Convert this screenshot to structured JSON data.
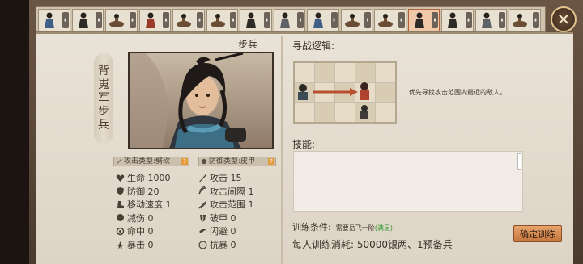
{
  "roster": [
    {
      "id": "unit-1",
      "icon": "figure-blue"
    },
    {
      "id": "unit-2",
      "icon": "figure-dark"
    },
    {
      "id": "unit-3",
      "icon": "figure-horse"
    },
    {
      "id": "unit-4",
      "icon": "figure-red"
    },
    {
      "id": "unit-5",
      "icon": "figure-horse"
    },
    {
      "id": "unit-6",
      "icon": "figure-horse"
    },
    {
      "id": "unit-7",
      "icon": "figure-dark"
    },
    {
      "id": "unit-8",
      "icon": "figure-grey"
    },
    {
      "id": "unit-9",
      "icon": "figure-blue"
    },
    {
      "id": "unit-10",
      "icon": "figure-horse"
    },
    {
      "id": "unit-11",
      "icon": "figure-horse"
    },
    {
      "id": "unit-12",
      "icon": "figure-dark",
      "active": true
    },
    {
      "id": "unit-13",
      "icon": "figure-dark"
    },
    {
      "id": "unit-14",
      "icon": "figure-grey"
    },
    {
      "id": "unit-15",
      "icon": "figure-horse"
    }
  ],
  "unit": {
    "type": "步兵",
    "name_chars": [
      "背",
      "嵬",
      "军",
      "步",
      "兵"
    ]
  },
  "types": {
    "attack": "攻击类型:劈砍",
    "defense": "防御类型:皮甲",
    "help_symbol": "?"
  },
  "stats_left": [
    {
      "icon": "heart-icon",
      "text": "生命 1000"
    },
    {
      "icon": "shield-icon",
      "text": "防御 20"
    },
    {
      "icon": "boot-icon",
      "text": "移动速度 1"
    },
    {
      "icon": "reduce-damage-icon",
      "text": "减伤 0"
    },
    {
      "icon": "accuracy-icon",
      "text": "命中 0"
    },
    {
      "icon": "critical-icon",
      "text": "暴击 0"
    }
  ],
  "stats_right": [
    {
      "icon": "sword-icon",
      "text": "攻击 15"
    },
    {
      "icon": "attack-interval-icon",
      "text": "攻击间隔 1"
    },
    {
      "icon": "attack-range-icon",
      "text": "攻击范围 1"
    },
    {
      "icon": "armor-break-icon",
      "text": "破甲 0"
    },
    {
      "icon": "dodge-icon",
      "text": "闪避 0"
    },
    {
      "icon": "anti-crit-icon",
      "text": "抗暴 0"
    }
  ],
  "pathfinding": {
    "label": "寻战逻辑:",
    "hint": "优先寻找攻击范围内最近的敌人。"
  },
  "skills": {
    "label": "技能:"
  },
  "training": {
    "requirement_label": "训练条件:",
    "requirement_value": "需要岳飞一阶",
    "requirement_status": "(满足)",
    "cost": "每人训练消耗: 50000银两、1预备兵",
    "confirm_label": "确定训练"
  },
  "colors": {
    "accent": "#c7773f",
    "paper": "#e9e2d6",
    "ok": "#2f9a2f"
  }
}
